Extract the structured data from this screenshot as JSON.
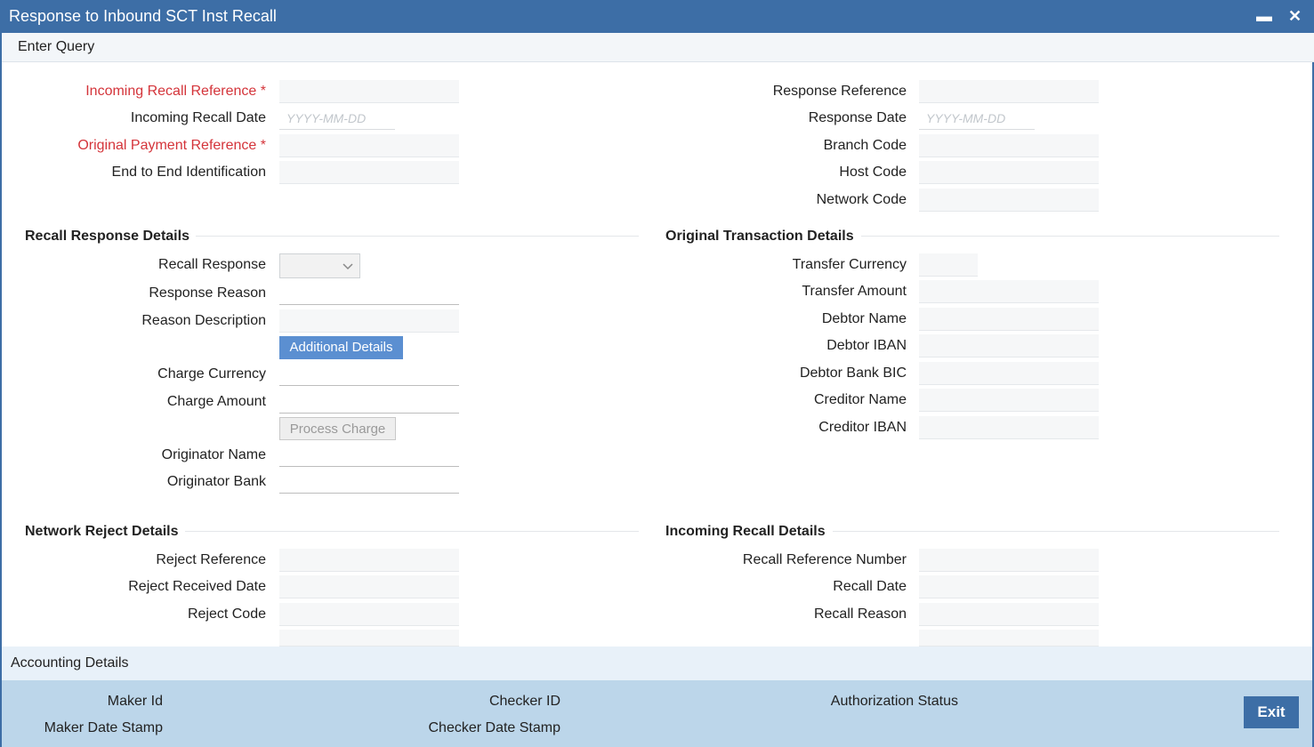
{
  "window": {
    "title": "Response to Inbound SCT Inst Recall",
    "minimize_icon": "minimize-icon",
    "close_icon": "close-icon"
  },
  "toolbar": {
    "enter_query": "Enter Query"
  },
  "header": {
    "incoming_recall_reference": "Incoming Recall Reference",
    "incoming_recall_date": "Incoming Recall Date",
    "original_payment_reference": "Original Payment Reference",
    "end_to_end_identification": "End to End Identification",
    "required_marker": "*",
    "date_placeholder": "YYYY-MM-DD",
    "response_reference": "Response Reference",
    "response_date": "Response Date",
    "branch_code": "Branch Code",
    "host_code": "Host Code",
    "network_code": "Network Code"
  },
  "recall_response_details": {
    "title": "Recall Response Details",
    "recall_response": "Recall Response",
    "response_reason": "Response Reason",
    "reason_description": "Reason Description",
    "additional_details_button": "Additional Details",
    "charge_currency": "Charge Currency",
    "charge_amount": "Charge Amount",
    "process_charge_button": "Process Charge",
    "originator_name": "Originator Name",
    "originator_bank": "Originator Bank"
  },
  "original_transaction_details": {
    "title": "Original Transaction Details",
    "transfer_currency": "Transfer Currency",
    "transfer_amount": "Transfer Amount",
    "debtor_name": "Debtor Name",
    "debtor_iban": "Debtor IBAN",
    "debtor_bank_bic": "Debtor Bank BIC",
    "creditor_name": "Creditor Name",
    "creditor_iban": "Creditor IBAN"
  },
  "network_reject_details": {
    "title": "Network Reject Details",
    "reject_reference": "Reject Reference",
    "reject_received_date": "Reject Received Date",
    "reject_code": "Reject Code"
  },
  "incoming_recall_details": {
    "title": "Incoming Recall Details",
    "recall_reference_number": "Recall Reference Number",
    "recall_date": "Recall Date",
    "recall_reason": "Recall Reason"
  },
  "accounting": {
    "label": "Accounting Details"
  },
  "footer": {
    "maker_id": "Maker Id",
    "maker_date_stamp": "Maker Date Stamp",
    "checker_id": "Checker ID",
    "checker_date_stamp": "Checker Date Stamp",
    "authorization_status": "Authorization Status",
    "exit_button": "Exit"
  },
  "colors": {
    "title_bar": "#3d6ea6",
    "required": "#d4343a",
    "button_primary": "#5b8fd1",
    "footer": "#bcd6ea"
  }
}
